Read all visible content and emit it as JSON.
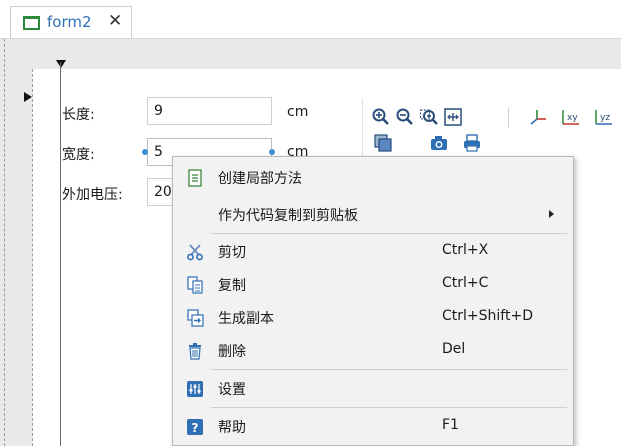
{
  "tab": {
    "label": "form2",
    "close_symbol": "✕"
  },
  "form": {
    "fields": [
      {
        "label": "长度:",
        "value": "9",
        "unit": "cm"
      },
      {
        "label": "宽度:",
        "value": "5",
        "unit": "cm"
      },
      {
        "label": "外加电压:",
        "value": "20"
      }
    ]
  },
  "toolbar": {
    "icons": [
      "zoom-in-icon",
      "zoom-out-icon",
      "zoom-box-icon",
      "zoom-extents-icon",
      "3d-axis-icon",
      "xy-view-icon",
      "yz-view-icon",
      "scene-light-icon",
      "camera-icon",
      "print-icon"
    ]
  },
  "context_menu": {
    "items": [
      {
        "label": "创建局部方法",
        "shortcut": "",
        "icon": "document-icon"
      },
      {
        "label": "作为代码复制到剪贴板",
        "shortcut": "",
        "submenu": true
      },
      {
        "label": "剪切",
        "shortcut": "Ctrl+X",
        "icon": "scissors-icon"
      },
      {
        "label": "复制",
        "shortcut": "Ctrl+C",
        "icon": "copy-icon"
      },
      {
        "label": "生成副本",
        "shortcut": "Ctrl+Shift+D",
        "icon": "duplicate-icon"
      },
      {
        "label": "删除",
        "shortcut": "Del",
        "icon": "trash-icon"
      },
      {
        "label": "设置",
        "shortcut": "",
        "icon": "settings-icon"
      },
      {
        "label": "帮助",
        "shortcut": "F1",
        "icon": "help-icon"
      }
    ]
  },
  "colors": {
    "accent": "#2f6fb3",
    "selection_handle": "#3d8fdc",
    "tab_icon": "#2c8a3c"
  }
}
